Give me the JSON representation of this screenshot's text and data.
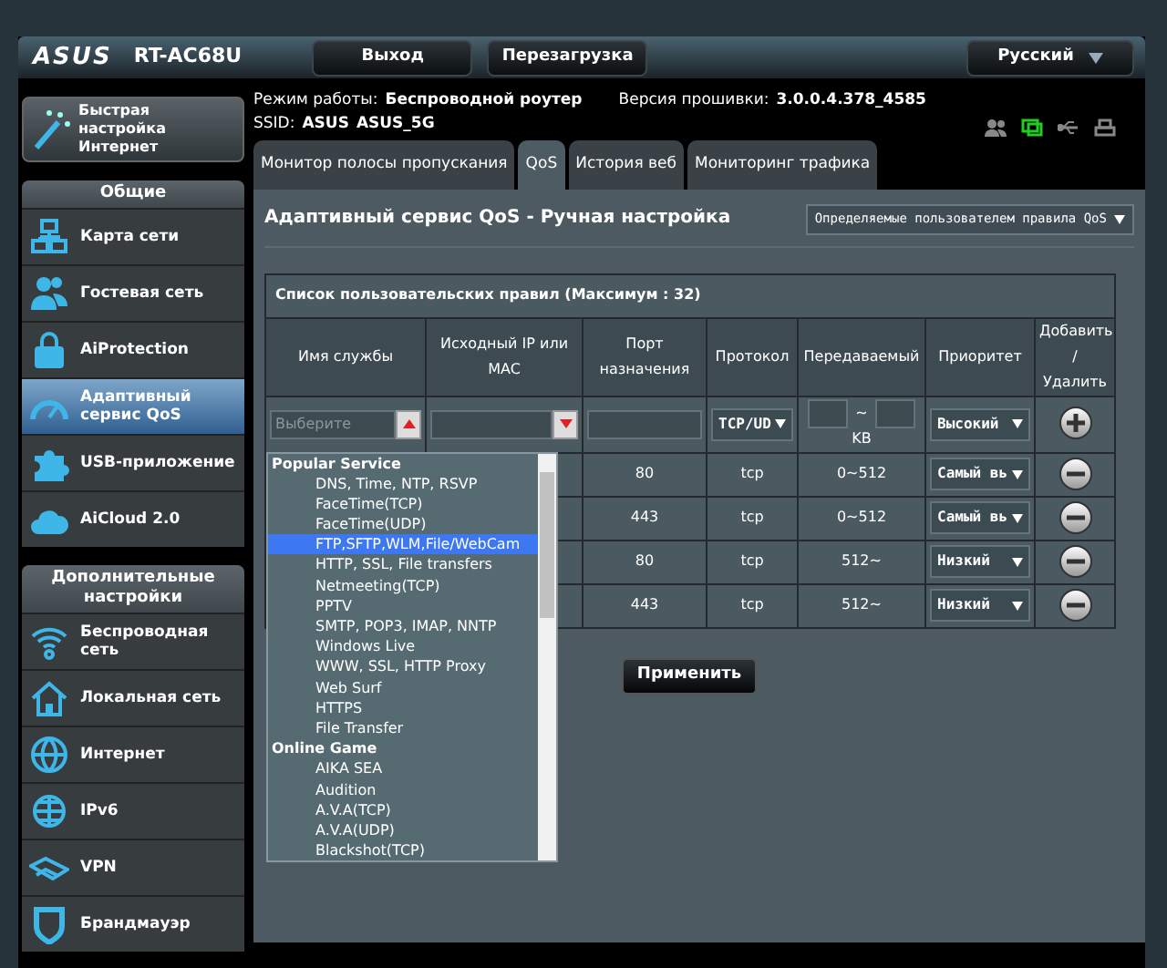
{
  "header": {
    "logo": "ASUS",
    "model": "RT-AC68U",
    "buttons": [
      "Выход",
      "Перезагрузка"
    ],
    "language": "Русский"
  },
  "quick_setup": {
    "label": "Быстрая настройка Интернет"
  },
  "sidebar": {
    "sections": [
      {
        "title": "Общие",
        "items": [
          {
            "label": "Карта сети",
            "kind": "network",
            "selected": false
          },
          {
            "label": "Гостевая сеть",
            "kind": "guest",
            "selected": false
          },
          {
            "label": "AiProtection",
            "kind": "lock",
            "selected": false
          },
          {
            "label": "Адаптивный сервис QoS",
            "kind": "gauge",
            "selected": true
          },
          {
            "label": "USB-приложение",
            "kind": "puzzle",
            "selected": false
          },
          {
            "label": "AiCloud 2.0",
            "kind": "cloud",
            "selected": false
          }
        ]
      },
      {
        "title": "Дополнительные настройки",
        "items": [
          {
            "label": "Беспроводная сеть",
            "kind": "wifi",
            "selected": false
          },
          {
            "label": "Локальная сеть",
            "kind": "house",
            "selected": false
          },
          {
            "label": "Интернет",
            "kind": "globe",
            "selected": false
          },
          {
            "label": "IPv6",
            "kind": "globe2",
            "selected": false
          },
          {
            "label": "VPN",
            "kind": "vpn",
            "selected": false
          },
          {
            "label": "Брандмауэр",
            "kind": "shield",
            "selected": false
          }
        ]
      }
    ]
  },
  "info": {
    "mode_label": "Режим работы:",
    "mode": "Беспроводной роутер",
    "firmware_label": "Версия прошивки:",
    "firmware": "3.0.0.4.378_4585",
    "ssid_label": "SSID:",
    "ssids": [
      "ASUS",
      "ASUS_5G"
    ]
  },
  "tabs": [
    {
      "label": "Монитор полосы пропускания",
      "selected": false
    },
    {
      "label": "QoS",
      "selected": true
    },
    {
      "label": "История веб",
      "selected": false
    },
    {
      "label": "Мониторинг трафика",
      "selected": false
    }
  ],
  "panel": {
    "title": "Адаптивный сервис QoS - Ручная настройка",
    "mode_select": "Определяемые пользователем правила QoS",
    "table": {
      "caption": "Список пользовательских правил (Максимум : 32)",
      "columns": [
        "Имя службы",
        "Исходный IP или MAC",
        "Порт назначения",
        "Протокол",
        "Передаваемый",
        "Приоритет",
        "Добавить / Удалить"
      ],
      "new_rule": {
        "service_placeholder": "Выберите",
        "protocol": "TCP/UD",
        "range_separator": "~",
        "unit": "KB",
        "priority": "Высокий"
      },
      "rows": [
        {
          "port": "80",
          "protocol": "tcp",
          "transferred": "0~512",
          "priority": "Самый вь"
        },
        {
          "port": "443",
          "protocol": "tcp",
          "transferred": "0~512",
          "priority": "Самый вь"
        },
        {
          "port": "80",
          "protocol": "tcp",
          "transferred": "512~",
          "priority": "Низкий"
        },
        {
          "port": "443",
          "protocol": "tcp",
          "transferred": "512~",
          "priority": "Низкий"
        }
      ]
    },
    "apply": "Применить",
    "service_dropdown": {
      "items": [
        {
          "kind": "group",
          "label": "Popular Service"
        },
        {
          "kind": "option",
          "label": "DNS, Time, NTP, RSVP",
          "selected": false
        },
        {
          "kind": "option",
          "label": "FaceTime(TCP)",
          "selected": false
        },
        {
          "kind": "option",
          "label": "FaceTime(UDP)",
          "selected": false
        },
        {
          "kind": "option",
          "label": "FTP,SFTP,WLM,File/WebCam",
          "selected": true
        },
        {
          "kind": "option",
          "label": "HTTP, SSL, File transfers",
          "selected": false
        },
        {
          "kind": "option",
          "label": "Netmeeting(TCP)",
          "selected": false
        },
        {
          "kind": "option",
          "label": "PPTV",
          "selected": false
        },
        {
          "kind": "option",
          "label": "SMTP, POP3, IMAP, NNTP",
          "selected": false
        },
        {
          "kind": "option",
          "label": "Windows Live",
          "selected": false
        },
        {
          "kind": "option",
          "label": "WWW, SSL, HTTP Proxy",
          "selected": false
        },
        {
          "kind": "option",
          "label": "Web Surf",
          "selected": false
        },
        {
          "kind": "option",
          "label": "HTTPS",
          "selected": false
        },
        {
          "kind": "option",
          "label": "File Transfer",
          "selected": false
        },
        {
          "kind": "group",
          "label": "Online Game"
        },
        {
          "kind": "option",
          "label": "AIKA SEA",
          "selected": false
        },
        {
          "kind": "option",
          "label": "Audition",
          "selected": false
        },
        {
          "kind": "option",
          "label": "A.V.A(TCP)",
          "selected": false
        },
        {
          "kind": "option",
          "label": "A.V.A(UDP)",
          "selected": false
        },
        {
          "kind": "option",
          "label": "Blackshot(TCP)",
          "selected": false
        }
      ]
    }
  }
}
